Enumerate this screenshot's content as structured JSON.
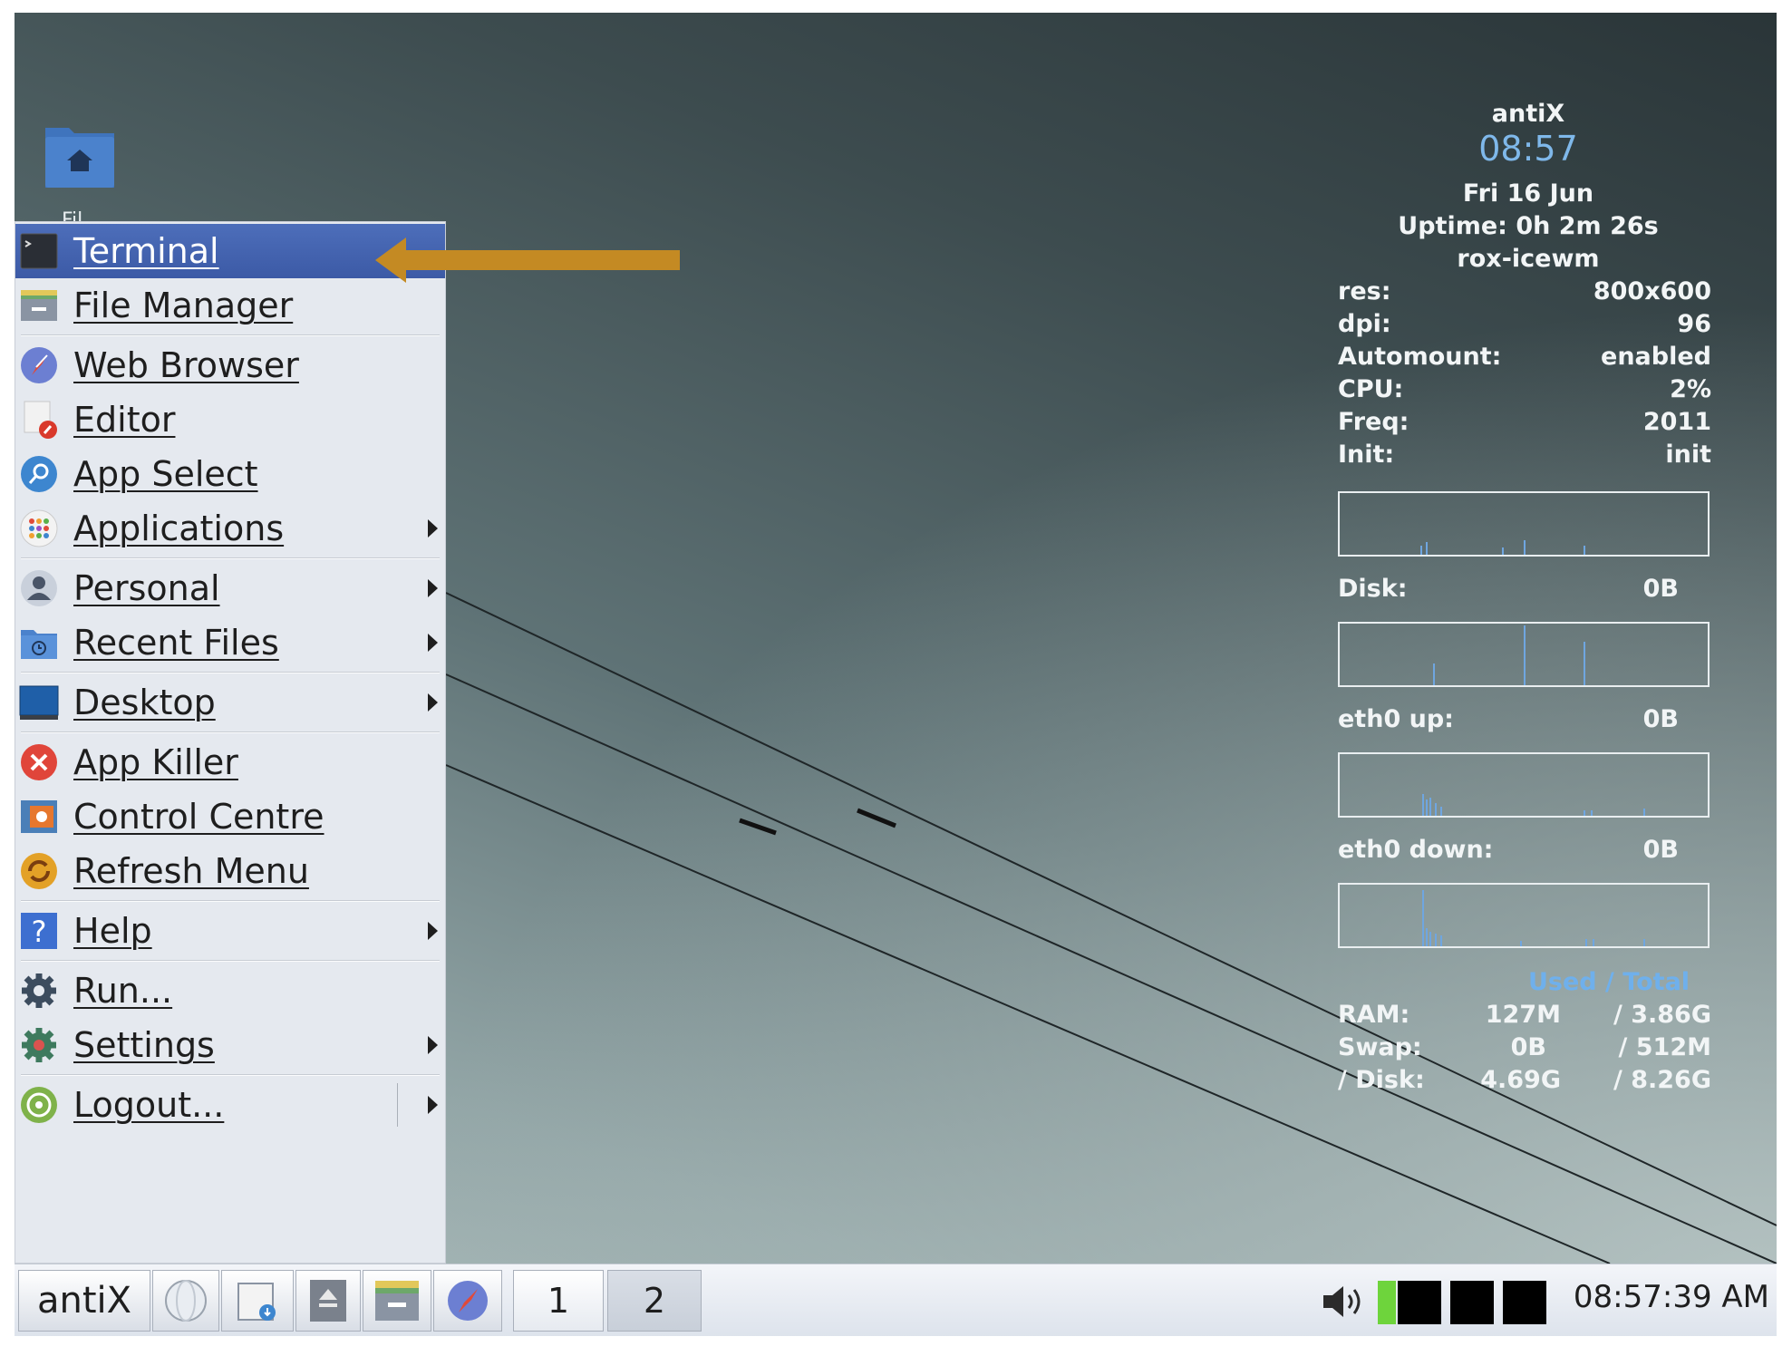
{
  "desktop": {
    "home_icon_label": "Fil",
    "colors": {
      "folder": "#4b82cc",
      "annotation_arrow": "#c48a23"
    }
  },
  "menu": {
    "items": [
      {
        "label": "Terminal",
        "icon": "terminal-icon",
        "submenu": false,
        "active": true
      },
      {
        "label": "File Manager",
        "icon": "file-manager-icon",
        "submenu": false
      },
      {
        "label": "Web Browser",
        "icon": "compass-icon",
        "submenu": false
      },
      {
        "label": "Editor",
        "icon": "editor-icon",
        "submenu": false
      },
      {
        "label": "App Select",
        "icon": "magnifier-icon",
        "submenu": false
      },
      {
        "label": "Applications",
        "icon": "app-grid-icon",
        "submenu": true
      },
      {
        "label": "Personal",
        "icon": "user-icon",
        "submenu": true
      },
      {
        "label": "Recent Files",
        "icon": "recent-files-icon",
        "submenu": true
      },
      {
        "label": "Desktop",
        "icon": "desktop-icon",
        "submenu": true
      },
      {
        "label": "App Killer",
        "icon": "kill-icon",
        "submenu": false
      },
      {
        "label": "Control Centre",
        "icon": "control-centre-icon",
        "submenu": false
      },
      {
        "label": "Refresh Menu",
        "icon": "refresh-icon",
        "submenu": false
      },
      {
        "label": "Help",
        "icon": "help-icon",
        "submenu": true
      },
      {
        "label": "Run...",
        "icon": "gear-icon",
        "submenu": false
      },
      {
        "label": "Settings",
        "icon": "settings-icon",
        "submenu": true
      },
      {
        "label": "Logout...",
        "icon": "logout-icon",
        "submenu": true
      }
    ]
  },
  "conky": {
    "distro": "antiX",
    "time": "08:57",
    "date": "Fri 16 Jun",
    "uptime": "Uptime: 0h 2m 26s",
    "session": "rox-icewm",
    "stats": [
      {
        "key": "res:",
        "value": "800x600"
      },
      {
        "key": "dpi:",
        "value": "96"
      },
      {
        "key": "Automount:",
        "value": "enabled"
      },
      {
        "key": "CPU:",
        "value": "2%"
      },
      {
        "key": "Freq:",
        "value": "2011"
      },
      {
        "key": "Init:",
        "value": "init"
      }
    ],
    "disk": {
      "key": "Disk:",
      "value": "0B"
    },
    "eth0_up": {
      "key": "eth0 up:",
      "value": "0B"
    },
    "eth0_down": {
      "key": "eth0 down:",
      "value": "0B"
    },
    "mem_header": "Used / Total",
    "mem": [
      {
        "key": "RAM:",
        "used": "127M",
        "total": "/ 3.86G"
      },
      {
        "key": "Swap:",
        "used": "0B",
        "total": "/ 512M"
      },
      {
        "key": "/ Disk:",
        "used": "4.69G",
        "total": "/ 8.26G"
      }
    ],
    "colors": {
      "time": "#7fb8ea",
      "mem_header": "#6fb0ec",
      "text": "#f2f5f6"
    }
  },
  "taskbar": {
    "start_label": "antiX",
    "workspaces": [
      "1",
      "2"
    ],
    "clock": "08:57:39 AM",
    "quick_launch": [
      "globe-icon",
      "file-manager-icon",
      "eject-icon",
      "file-manager-icon",
      "compass-icon"
    ],
    "tray": [
      "volume-icon",
      "cpu-monitor",
      "net-monitor",
      "net-monitor",
      "mem-monitor"
    ]
  }
}
